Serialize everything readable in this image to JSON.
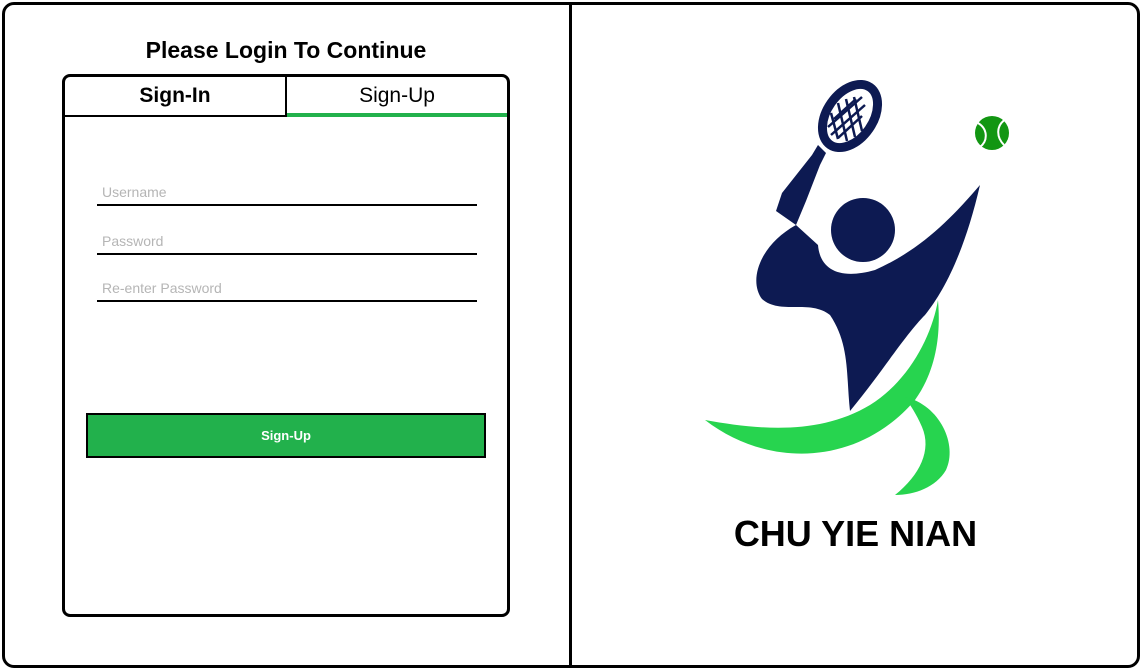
{
  "login_panel": {
    "title": "Please Login To Continue",
    "tabs": [
      {
        "label": "Sign-In",
        "active": false
      },
      {
        "label": "Sign-Up",
        "active": true
      }
    ],
    "fields": {
      "username": {
        "value": "",
        "placeholder": "Username"
      },
      "password": {
        "value": "",
        "placeholder": "Password"
      },
      "reenter_password": {
        "value": "",
        "placeholder": "Re-enter Password"
      }
    },
    "submit_label": "Sign-Up"
  },
  "brand": {
    "name": "CHU YIE NIAN",
    "logo_icon": "tennis-player-logo-icon",
    "colors": {
      "navy": "#0d1a52",
      "green": "#22b14c",
      "accent_green": "#27d44f",
      "ball_green": "#129612"
    }
  }
}
